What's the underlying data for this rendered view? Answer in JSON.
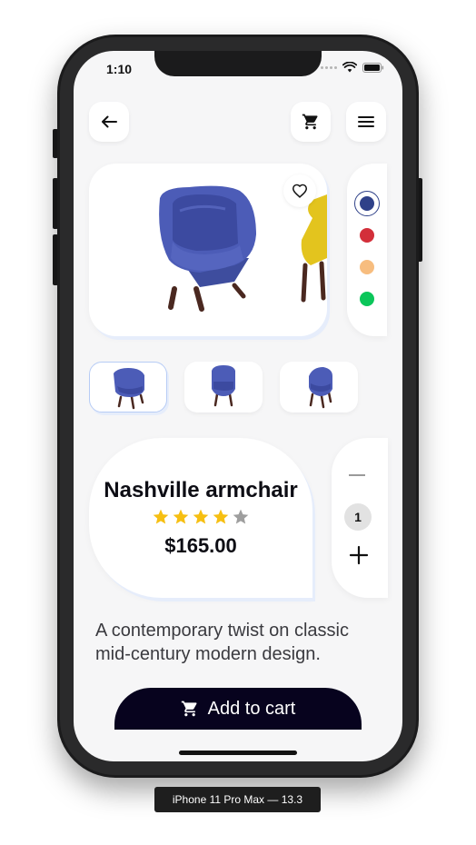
{
  "status_bar": {
    "time": "1:10"
  },
  "header": {
    "back_icon": "arrow-left-icon",
    "cart_icon": "cart-icon",
    "menu_icon": "menu-icon"
  },
  "product": {
    "name": "Nashville armchair",
    "rating": 4,
    "max_rating": 5,
    "price": "$165.00",
    "description": "A contemporary twist on classic mid-century modern design."
  },
  "colors": [
    "#2f4189",
    "#d32f3a",
    "#f7bd7f",
    "#0bc65a"
  ],
  "selected_color_index": 0,
  "quantity": "1",
  "add_to_cart_label": "Add to cart",
  "device_label": "iPhone 11 Pro Max — 13.3",
  "accent": {
    "star": "#f6bf12",
    "star_empty": "#9e9e9e",
    "button": "#07031e"
  }
}
